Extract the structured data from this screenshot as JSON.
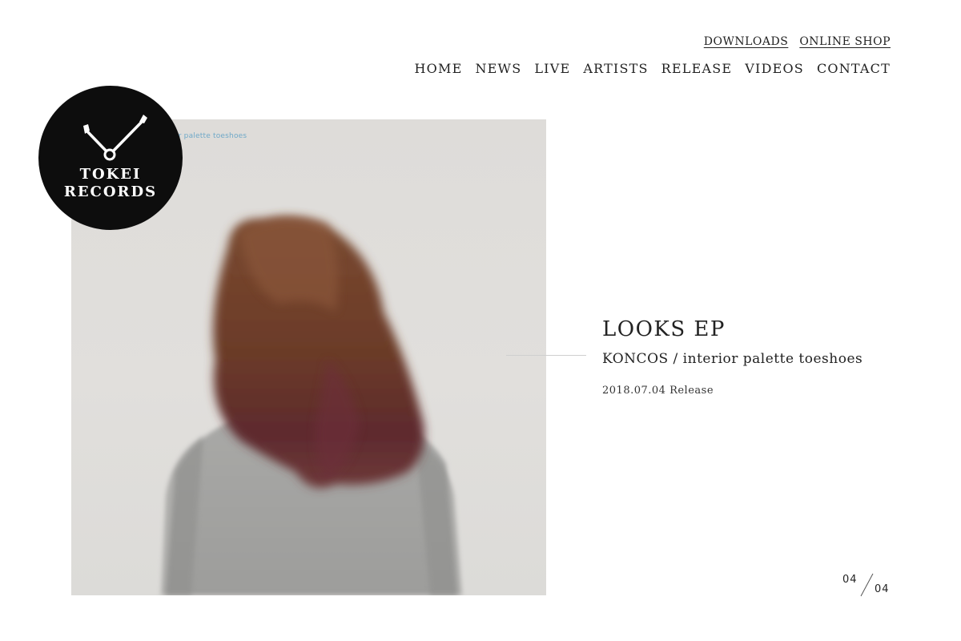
{
  "utility_nav": {
    "downloads": "DOWNLOADS",
    "online_shop": "ONLINE SHOP"
  },
  "main_nav": {
    "items": [
      "HOME",
      "NEWS",
      "LIVE",
      "ARTISTS",
      "RELEASE",
      "VIDEOS",
      "CONTACT"
    ]
  },
  "logo": {
    "line1": "TOKEI",
    "line2": "RECORDS",
    "icon": "clock-hands-icon"
  },
  "cover": {
    "caption": "or palette toeshoes"
  },
  "release": {
    "title": "LOOKS EP",
    "artist": "KONCOS / interior palette toeshoes",
    "date": "2018.07.04 Release"
  },
  "pager": {
    "current": "04",
    "total": "04"
  },
  "colors": {
    "background": "#ffffff",
    "text": "#222222",
    "logo_bg": "#0d0d0d",
    "cover_caption": "#6fa9c8"
  }
}
